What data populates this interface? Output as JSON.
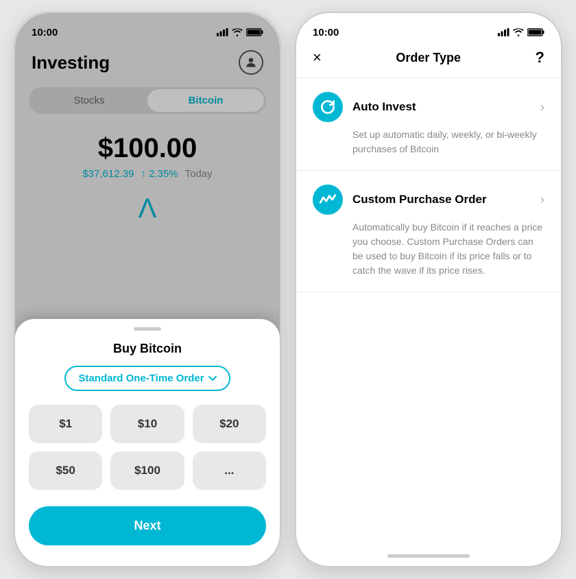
{
  "left_phone": {
    "status_time": "10:00",
    "header": {
      "title": "Investing"
    },
    "tabs": [
      {
        "label": "Stocks",
        "active": false
      },
      {
        "label": "Bitcoin",
        "active": true
      }
    ],
    "price": "$100.00",
    "btc_price": "$37,612.39",
    "change": "↑ 2.35%",
    "period": "Today",
    "bottom_sheet": {
      "title": "Buy Bitcoin",
      "order_type": "Standard One-Time Order",
      "amounts": [
        "$1",
        "$10",
        "$20",
        "$50",
        "$100",
        "..."
      ],
      "next_label": "Next"
    }
  },
  "right_phone": {
    "status_time": "10:00",
    "header_title": "Order Type",
    "close_label": "×",
    "help_label": "?",
    "options": [
      {
        "name": "Auto Invest",
        "desc": "Set up automatic daily, weekly, or bi-weekly purchases of Bitcoin",
        "icon": "refresh"
      },
      {
        "name": "Custom Purchase Order",
        "desc": "Automatically buy Bitcoin if it reaches a price you choose. Custom Purchase Orders can be used to buy Bitcoin if its price falls or to catch the wave if its price rises.",
        "icon": "chart"
      }
    ]
  }
}
